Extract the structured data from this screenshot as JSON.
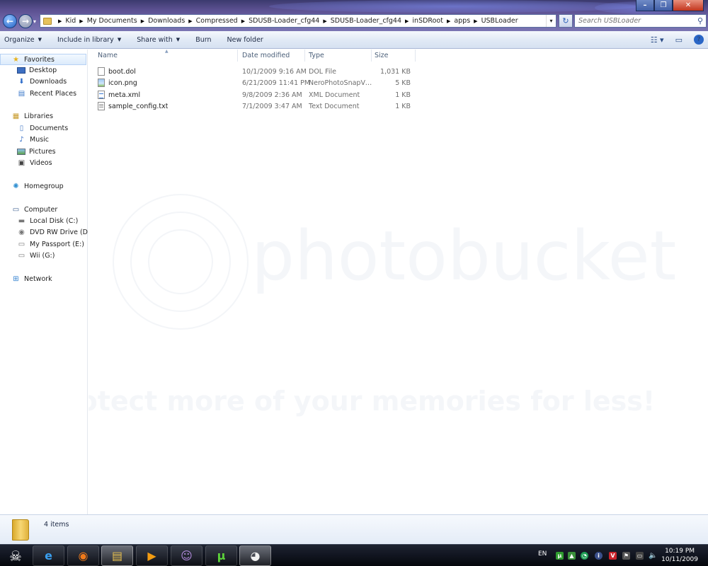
{
  "address": {
    "crumbs": [
      "Kid",
      "My Documents",
      "Downloads",
      "Compressed",
      "SDUSB-Loader_cfg44",
      "SDUSB-Loader_cfg44",
      "inSDRoot",
      "apps",
      "USBLoader"
    ]
  },
  "search": {
    "placeholder": "Search USBLoader"
  },
  "toolbar": {
    "organize": "Organize",
    "include_in_library": "Include in library",
    "share_with": "Share with",
    "burn": "Burn",
    "new_folder": "New folder"
  },
  "sidebar": {
    "favorites": "Favorites",
    "desktop": "Desktop",
    "downloads": "Downloads",
    "recent_places": "Recent Places",
    "libraries": "Libraries",
    "documents": "Documents",
    "music": "Music",
    "pictures": "Pictures",
    "videos": "Videos",
    "homegroup": "Homegroup",
    "computer": "Computer",
    "local_disk": "Local Disk (C:)",
    "dvd_drive": "DVD RW Drive (D:)",
    "my_passport": "My Passport (E:)",
    "wii": "Wii (G:)",
    "network": "Network"
  },
  "columns": {
    "name": "Name",
    "date_modified": "Date modified",
    "type": "Type",
    "size": "Size"
  },
  "files": [
    {
      "name": "boot.dol",
      "date": "10/1/2009 9:16 AM",
      "type": "DOL File",
      "size": "1,031 KB",
      "icon": "generic-file-icon"
    },
    {
      "name": "icon.png",
      "date": "6/21/2009 11:41 PM",
      "type": "NeroPhotoSnapVi...",
      "size": "5 KB",
      "icon": "image-file-icon"
    },
    {
      "name": "meta.xml",
      "date": "9/8/2009 2:36 AM",
      "type": "XML Document",
      "size": "1 KB",
      "icon": "xml-file-icon"
    },
    {
      "name": "sample_config.txt",
      "date": "7/1/2009 3:47 AM",
      "type": "Text Document",
      "size": "1 KB",
      "icon": "text-file-icon"
    }
  ],
  "details": {
    "item_count": "4 items"
  },
  "watermark": {
    "logo": "photobucket",
    "tagline": "Protect more of your memories for less!"
  },
  "taskbar": {
    "language": "EN",
    "time": "10:19 PM",
    "date": "10/11/2009"
  }
}
